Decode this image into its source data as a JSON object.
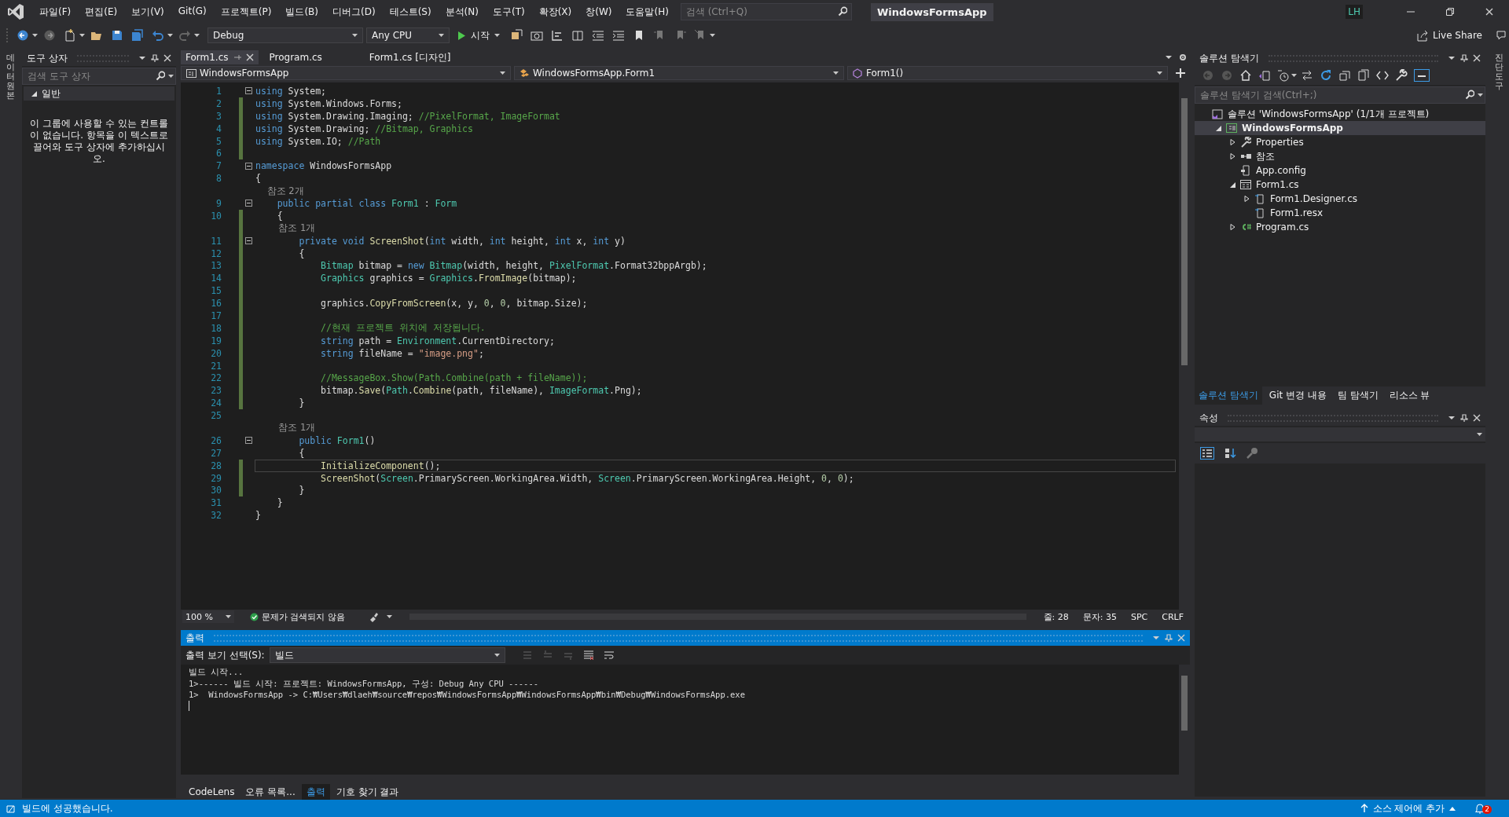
{
  "title_bar": {
    "menus": [
      "파일(F)",
      "편집(E)",
      "보기(V)",
      "Git(G)",
      "프로젝트(P)",
      "빌드(B)",
      "디버그(D)",
      "테스트(S)",
      "분석(N)",
      "도구(T)",
      "확장(X)",
      "창(W)",
      "도움말(H)"
    ],
    "search": {
      "placeholder": "검색 (Ctrl+Q)"
    },
    "title": "WindowsFormsApp",
    "avatar": "LH"
  },
  "toolbar": {
    "configuration": "Debug",
    "platform": "Any CPU",
    "start": "시작",
    "live_share": "Live Share"
  },
  "side_tabs": {
    "left": "데이터 원본",
    "right": "진단 도구"
  },
  "toolbox": {
    "title": "도구 상자",
    "search": {
      "placeholder": "검색 도구 상자"
    },
    "group": {
      "label": "일반",
      "expanded": true
    },
    "empty_message": "이 그룹에 사용할 수 있는 컨트롤이 없습니다. 항목을 이 텍스트로 끌어와 도구 상자에 추가하십시오."
  },
  "editor": {
    "tabs": [
      {
        "label": "Form1.cs",
        "selected": true
      },
      {
        "label": "Program.cs",
        "selected": false
      },
      {
        "label": "Form1.cs [디자인]",
        "selected": false
      }
    ],
    "navigation": [
      {
        "kind": "project",
        "label": "WindowsFormsApp"
      },
      {
        "kind": "class",
        "label": "WindowsFormsApp.Form1"
      },
      {
        "kind": "member",
        "label": "Form1()"
      }
    ],
    "lines": [
      {
        "kind": "code",
        "n": "1",
        "fold": true,
        "changed": false,
        "current": false,
        "code": [
          {
            "kind": "keyword",
            "text": "using"
          },
          {
            "kind": "plain",
            "text": " System;"
          }
        ]
      },
      {
        "kind": "code",
        "n": "2",
        "fold": false,
        "changed": true,
        "current": false,
        "code": [
          {
            "kind": "keyword",
            "text": "using"
          },
          {
            "kind": "plain",
            "text": " System.Windows.Forms;"
          }
        ]
      },
      {
        "kind": "code",
        "n": "3",
        "fold": false,
        "changed": true,
        "current": false,
        "code": [
          {
            "kind": "keyword",
            "text": "using"
          },
          {
            "kind": "plain",
            "text": " System.Drawing.Imaging; "
          },
          {
            "kind": "comment",
            "text": "//PixelFormat, ImageFormat"
          }
        ]
      },
      {
        "kind": "code",
        "n": "4",
        "fold": false,
        "changed": true,
        "current": false,
        "code": [
          {
            "kind": "keyword",
            "text": "using"
          },
          {
            "kind": "plain",
            "text": " System.Drawing; "
          },
          {
            "kind": "comment",
            "text": "//Bitmap, Graphics"
          }
        ]
      },
      {
        "kind": "code",
        "n": "5",
        "fold": false,
        "changed": true,
        "current": false,
        "code": [
          {
            "kind": "keyword",
            "text": "using"
          },
          {
            "kind": "plain",
            "text": " System.IO; "
          },
          {
            "kind": "comment",
            "text": "//Path"
          }
        ]
      },
      {
        "kind": "code",
        "n": "6",
        "fold": false,
        "changed": true,
        "current": false
      },
      {
        "kind": "code",
        "n": "7",
        "fold": true,
        "changed": false,
        "current": false,
        "code": [
          {
            "kind": "keyword",
            "text": "namespace"
          },
          {
            "kind": "plain",
            "text": " WindowsFormsApp"
          }
        ]
      },
      {
        "kind": "code",
        "n": "8",
        "fold": false,
        "changed": false,
        "current": false,
        "code": [
          {
            "kind": "plain",
            "text": "{"
          }
        ]
      },
      {
        "kind": "lens",
        "text": "    참조 2개",
        "changed": false
      },
      {
        "kind": "code",
        "n": "9",
        "fold": true,
        "changed": false,
        "current": false,
        "code": [
          {
            "kind": "keyword",
            "text": "    public partial class"
          },
          {
            "kind": "type",
            "text": " Form1"
          },
          {
            "kind": "plain",
            "text": " : "
          },
          {
            "kind": "type",
            "text": "Form"
          }
        ]
      },
      {
        "kind": "code",
        "n": "10",
        "fold": false,
        "changed": true,
        "current": false,
        "code": [
          {
            "kind": "plain",
            "text": "    {"
          }
        ]
      },
      {
        "kind": "lens",
        "text": "        참조 1개",
        "changed": true
      },
      {
        "kind": "code",
        "n": "11",
        "fold": true,
        "changed": true,
        "current": false,
        "code": [
          {
            "kind": "keyword",
            "text": "        private void"
          },
          {
            "kind": "method",
            "text": " ScreenShot"
          },
          {
            "kind": "plain",
            "text": "("
          },
          {
            "kind": "keyword",
            "text": "int"
          },
          {
            "kind": "plain",
            "text": " width, "
          },
          {
            "kind": "keyword",
            "text": "int"
          },
          {
            "kind": "plain",
            "text": " height, "
          },
          {
            "kind": "keyword",
            "text": "int"
          },
          {
            "kind": "plain",
            "text": " x, "
          },
          {
            "kind": "keyword",
            "text": "int"
          },
          {
            "kind": "plain",
            "text": " y)"
          }
        ]
      },
      {
        "kind": "code",
        "n": "12",
        "fold": false,
        "changed": true,
        "current": false,
        "code": [
          {
            "kind": "plain",
            "text": "        {"
          }
        ]
      },
      {
        "kind": "code",
        "n": "13",
        "fold": false,
        "changed": true,
        "current": false,
        "code": [
          {
            "kind": "type",
            "text": "            Bitmap"
          },
          {
            "kind": "plain",
            "text": " bitmap = "
          },
          {
            "kind": "keyword",
            "text": "new"
          },
          {
            "kind": "type",
            "text": " Bitmap"
          },
          {
            "kind": "plain",
            "text": "(width, height, "
          },
          {
            "kind": "type",
            "text": "PixelFormat"
          },
          {
            "kind": "plain",
            "text": ".Format32bppArgb);"
          }
        ]
      },
      {
        "kind": "code",
        "n": "14",
        "fold": false,
        "changed": true,
        "current": false,
        "code": [
          {
            "kind": "type",
            "text": "            Graphics"
          },
          {
            "kind": "plain",
            "text": " graphics = "
          },
          {
            "kind": "type",
            "text": "Graphics"
          },
          {
            "kind": "plain",
            "text": "."
          },
          {
            "kind": "method",
            "text": "FromImage"
          },
          {
            "kind": "plain",
            "text": "(bitmap);"
          }
        ]
      },
      {
        "kind": "code",
        "n": "15",
        "fold": false,
        "changed": true,
        "current": false
      },
      {
        "kind": "code",
        "n": "16",
        "fold": false,
        "changed": true,
        "current": false,
        "code": [
          {
            "kind": "plain",
            "text": "            graphics."
          },
          {
            "kind": "method",
            "text": "CopyFromScreen"
          },
          {
            "kind": "plain",
            "text": "(x, y, "
          },
          {
            "kind": "number",
            "text": "0"
          },
          {
            "kind": "plain",
            "text": ", "
          },
          {
            "kind": "number",
            "text": "0"
          },
          {
            "kind": "plain",
            "text": ", bitmap.Size);"
          }
        ]
      },
      {
        "kind": "code",
        "n": "17",
        "fold": false,
        "changed": true,
        "current": false
      },
      {
        "kind": "code",
        "n": "18",
        "fold": false,
        "changed": true,
        "current": false,
        "code": [
          {
            "kind": "comment",
            "text": "            //현재 프로젝트 위치에 저장됩니다."
          }
        ]
      },
      {
        "kind": "code",
        "n": "19",
        "fold": false,
        "changed": true,
        "current": false,
        "code": [
          {
            "kind": "keyword",
            "text": "            string"
          },
          {
            "kind": "plain",
            "text": " path = "
          },
          {
            "kind": "type",
            "text": "Environment"
          },
          {
            "kind": "plain",
            "text": ".CurrentDirectory;"
          }
        ]
      },
      {
        "kind": "code",
        "n": "20",
        "fold": false,
        "changed": true,
        "current": false,
        "code": [
          {
            "kind": "keyword",
            "text": "            string"
          },
          {
            "kind": "plain",
            "text": " fileName = "
          },
          {
            "kind": "string",
            "text": "\"image.png\""
          },
          {
            "kind": "plain",
            "text": ";"
          }
        ]
      },
      {
        "kind": "code",
        "n": "21",
        "fold": false,
        "changed": true,
        "current": false
      },
      {
        "kind": "code",
        "n": "22",
        "fold": false,
        "changed": true,
        "current": false,
        "code": [
          {
            "kind": "comment",
            "text": "            //MessageBox.Show(Path.Combine(path + fileName));"
          }
        ]
      },
      {
        "kind": "code",
        "n": "23",
        "fold": false,
        "changed": true,
        "current": false,
        "code": [
          {
            "kind": "plain",
            "text": "            bitmap."
          },
          {
            "kind": "method",
            "text": "Save"
          },
          {
            "kind": "plain",
            "text": "("
          },
          {
            "kind": "type",
            "text": "Path"
          },
          {
            "kind": "plain",
            "text": "."
          },
          {
            "kind": "method",
            "text": "Combine"
          },
          {
            "kind": "plain",
            "text": "(path, fileName), "
          },
          {
            "kind": "type",
            "text": "ImageFormat"
          },
          {
            "kind": "plain",
            "text": ".Png);"
          }
        ]
      },
      {
        "kind": "code",
        "n": "24",
        "fold": false,
        "changed": true,
        "current": false,
        "code": [
          {
            "kind": "plain",
            "text": "        }"
          }
        ]
      },
      {
        "kind": "code",
        "n": "25",
        "fold": false,
        "changed": false,
        "current": false
      },
      {
        "kind": "lens",
        "text": "        참조 1개",
        "changed": false
      },
      {
        "kind": "code",
        "n": "26",
        "fold": true,
        "changed": false,
        "current": false,
        "code": [
          {
            "kind": "keyword",
            "text": "        public"
          },
          {
            "kind": "type",
            "text": " Form1"
          },
          {
            "kind": "plain",
            "text": "()"
          }
        ]
      },
      {
        "kind": "code",
        "n": "27",
        "fold": false,
        "changed": false,
        "current": false,
        "code": [
          {
            "kind": "plain",
            "text": "        {"
          }
        ]
      },
      {
        "kind": "code",
        "n": "28",
        "fold": false,
        "changed": true,
        "current": true,
        "code": [
          {
            "kind": "method",
            "text": "            InitializeComponent"
          },
          {
            "kind": "plain",
            "text": "();"
          }
        ]
      },
      {
        "kind": "code",
        "n": "29",
        "fold": false,
        "changed": true,
        "current": false,
        "code": [
          {
            "kind": "method",
            "text": "            ScreenShot"
          },
          {
            "kind": "plain",
            "text": "("
          },
          {
            "kind": "type",
            "text": "Screen"
          },
          {
            "kind": "plain",
            "text": ".PrimaryScreen.WorkingArea.Width, "
          },
          {
            "kind": "type",
            "text": "Screen"
          },
          {
            "kind": "plain",
            "text": ".PrimaryScreen.WorkingArea.Height, "
          },
          {
            "kind": "number",
            "text": "0"
          },
          {
            "kind": "plain",
            "text": ", "
          },
          {
            "kind": "number",
            "text": "0"
          },
          {
            "kind": "plain",
            "text": ");"
          }
        ]
      },
      {
        "kind": "code",
        "n": "30",
        "fold": false,
        "changed": true,
        "current": false,
        "code": [
          {
            "kind": "plain",
            "text": "        }"
          }
        ]
      },
      {
        "kind": "code",
        "n": "31",
        "fold": false,
        "changed": false,
        "current": false,
        "code": [
          {
            "kind": "plain",
            "text": "    }"
          }
        ]
      },
      {
        "kind": "code",
        "n": "32",
        "fold": false,
        "changed": false,
        "current": false,
        "code": [
          {
            "kind": "plain",
            "text": "}"
          }
        ]
      }
    ],
    "status": {
      "zoom": "100 %",
      "issues": "문제가 검색되지 않음",
      "line": "줄: 28",
      "column": "문자: 35",
      "indent": "SPC",
      "line_endings": "CRLF"
    }
  },
  "output": {
    "title": "출력",
    "source_label": "출력 보기 선택(S):",
    "source": "빌드",
    "lines": [
      "빌드 시작...",
      "1>------ 빌드 시작: 프로젝트: WindowsFormsApp, 구성: Debug Any CPU ------",
      "1>  WindowsFormsApp -> C:₩Users₩dlaeh₩source₩repos₩WindowsFormsApp₩WindowsFormsApp₩bin₩Debug₩WindowsFormsApp.exe"
    ]
  },
  "bottom_tabs": [
    {
      "label": "CodeLens",
      "selected": false
    },
    {
      "label": "오류 목록...",
      "selected": false
    },
    {
      "label": "출력",
      "selected": true
    },
    {
      "label": "기호 찾기 결과",
      "selected": false
    }
  ],
  "solution_explorer": {
    "title": "솔루션 탐색기",
    "search": {
      "placeholder": "솔루션 탐색기 검색(Ctrl+;)"
    },
    "tree": [
      {
        "kind": "solution",
        "label": "솔루션 'WindowsFormsApp' (1/1개 프로젝트)",
        "expandable": false,
        "expanded": true,
        "selected": false,
        "children": [
          {
            "kind": "project",
            "label": "WindowsFormsApp",
            "expandable": true,
            "expanded": true,
            "selected": true,
            "children": [
              {
                "kind": "properties",
                "label": "Properties",
                "expandable": true,
                "expanded": false,
                "selected": false
              },
              {
                "kind": "references",
                "label": "참조",
                "expandable": true,
                "expanded": false,
                "selected": false
              },
              {
                "kind": "config",
                "label": "App.config",
                "expandable": false,
                "selected": false
              },
              {
                "kind": "form",
                "label": "Form1.cs",
                "expandable": true,
                "expanded": true,
                "selected": false,
                "children": [
                  {
                    "kind": "file",
                    "label": "Form1.Designer.cs",
                    "expandable": true,
                    "expanded": false,
                    "selected": false
                  },
                  {
                    "kind": "file",
                    "label": "Form1.resx",
                    "expandable": false,
                    "selected": false
                  }
                ]
              },
              {
                "kind": "csharp",
                "label": "Program.cs",
                "expandable": true,
                "expanded": false,
                "selected": false
              }
            ]
          }
        ]
      }
    ],
    "tabs": [
      {
        "label": "솔루션 탐색기",
        "selected": true
      },
      {
        "label": "Git 변경 내용",
        "selected": false
      },
      {
        "label": "팀 탐색기",
        "selected": false
      },
      {
        "label": "리소스 뷰",
        "selected": false
      }
    ]
  },
  "properties": {
    "title": "속성"
  },
  "status_bar": {
    "message": "빌드에 성공했습니다.",
    "source_control": "소스 제어에 추가",
    "notifications": "2"
  }
}
